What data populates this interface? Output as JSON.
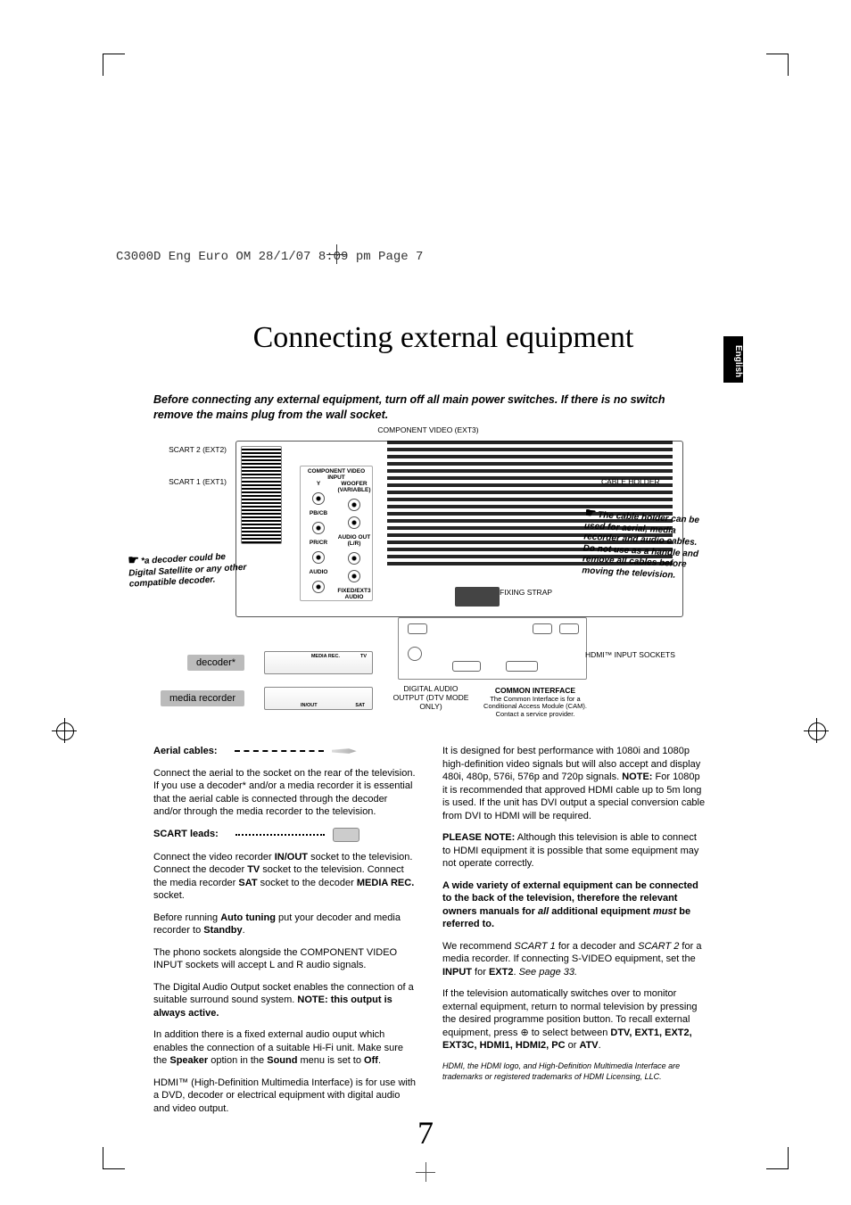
{
  "slug": "C3000D Eng Euro OM  28/1/07  8:09 pm  Page 7",
  "language_tab": "English",
  "title": "Connecting external equipment",
  "intro": "Before connecting any external equipment, turn off all main power switches. If there is no switch remove the mains plug from the wall socket.",
  "diagram": {
    "top_label": "COMPONENT VIDEO (EXT3)",
    "scart2": "SCART 2 (EXT2)",
    "scart1": "SCART 1 (EXT1)",
    "cable_holder": "CABLE HOLDER",
    "fixing_strap": "FIXING STRAP",
    "hdmi_sockets": "HDMI™ INPUT SOCKETS",
    "common_interface_title": "COMMON INTERFACE",
    "common_interface_note": "The Common Interface is for a Conditional Access Module (CAM). Contact a service provider.",
    "digital_audio": "DIGITAL AUDIO OUTPUT (DTV MODE ONLY)",
    "decoder_box": "decoder*",
    "media_recorder_box": "media recorder",
    "callout_decoder": "*a decoder could be Digital Satellite or any other compatible decoder.",
    "callout_cable": "The cable holder can be used for aerial, media recorder and audio cables. Do not use as a handle and remove all cables before moving the television.",
    "panel_text": {
      "ext3_component": "COMPONENT VIDEO INPUT",
      "woofer": "WOOFER (VARIABLE)",
      "y": "Y",
      "pb": "PB/CB",
      "pr": "PR/CR",
      "audio": "AUDIO",
      "audio_out": "AUDIO OUT (L/R)",
      "fixed_audio": "FIXED/EXT3 AUDIO"
    },
    "device_ports": {
      "tv": "TV",
      "media_rec": "MEDIA REC.",
      "in_out": "IN/OUT",
      "sat": "SAT"
    }
  },
  "left_col": {
    "head_aerial": "Aerial cables:",
    "p1": "Connect the aerial to the socket on the rear of the television. If you use a decoder* and/or a media recorder it is essential that the aerial cable is connected through the decoder and/or through the media recorder to the television.",
    "head_scart": "SCART leads:",
    "p2a": "Connect the video recorder ",
    "p2b": " socket to the television. Connect the decoder ",
    "p2c": " socket to the television. Connect the media recorder ",
    "p2d": " socket to the decoder ",
    "p2e": " socket.",
    "p2_inout": "IN/OUT",
    "p2_tv": "TV",
    "p2_sat": "SAT",
    "p2_mediarec": "MEDIA REC.",
    "p3a": "Before running ",
    "p3_auto": "Auto tuning",
    "p3b": " put your decoder and media recorder to ",
    "p3_standby": "Standby",
    "p3c": ".",
    "p4": "The phono sockets alongside the COMPONENT VIDEO INPUT sockets will accept L and R audio signals.",
    "p5a": "The Digital Audio Output socket enables the connection of a suitable surround sound system. ",
    "p5_note": "NOTE: this output is always active.",
    "p6a": "In addition there is a fixed external audio ouput which enables the connection of a suitable Hi-Fi unit. Make sure the ",
    "p6_speaker": "Speaker",
    "p6b": " option in the ",
    "p6_sound": "Sound",
    "p6c": " menu is set to ",
    "p6_off": "Off",
    "p6d": ".",
    "p7": "HDMI™ (High-Definition Multimedia Interface) is for use with a DVD, decoder or electrical equipment with digital audio and video output."
  },
  "right_col": {
    "p1a": "It is designed for best performance with 1080i and 1080p high-definition video signals but will also accept and display 480i, 480p, 576i, 576p and 720p signals. ",
    "p1_note": "NOTE:",
    "p1b": " For 1080p it is recommended that approved HDMI cable up to 5m long is used. If the unit has DVI output a special conversion cable from DVI to HDMI will be required.",
    "p2_note": "PLEASE NOTE:",
    "p2": " Although this television is able to connect to HDMI equipment it is possible that some equipment may not operate correctly.",
    "p3a": "A wide variety of external equipment can be connected to the back of the television, therefore the relevant owners manuals for ",
    "p3_all": "all",
    "p3b": " additional equipment ",
    "p3_must": "must",
    "p3c": " be referred to.",
    "p4a": "We recommend ",
    "p4_s1": "SCART 1",
    "p4b": " for a decoder and ",
    "p4_s2": "SCART 2",
    "p4c": " for a media recorder. If connecting S-VIDEO equipment, set the ",
    "p4_input": "INPUT",
    "p4d": " for ",
    "p4_ext2": "EXT2",
    "p4e": ". ",
    "p4_see": "See page 33.",
    "p5a": "If the television automatically switches over to monitor external equipment, return to normal television by pressing the desired programme position button. To recall external equipment, press ",
    "p5_icon": "⊕",
    "p5b": " to select between ",
    "p5_list": "DTV, EXT1, EXT2, EXT3C, HDMI1, HDMI2, PC",
    "p5c": " or ",
    "p5_atv": "ATV",
    "p5d": ".",
    "trademark": "HDMI, the HDMI logo, and High-Definition Multimedia Interface are trademarks or registered trademarks of HDMI Licensing, LLC."
  },
  "page_number": "7"
}
